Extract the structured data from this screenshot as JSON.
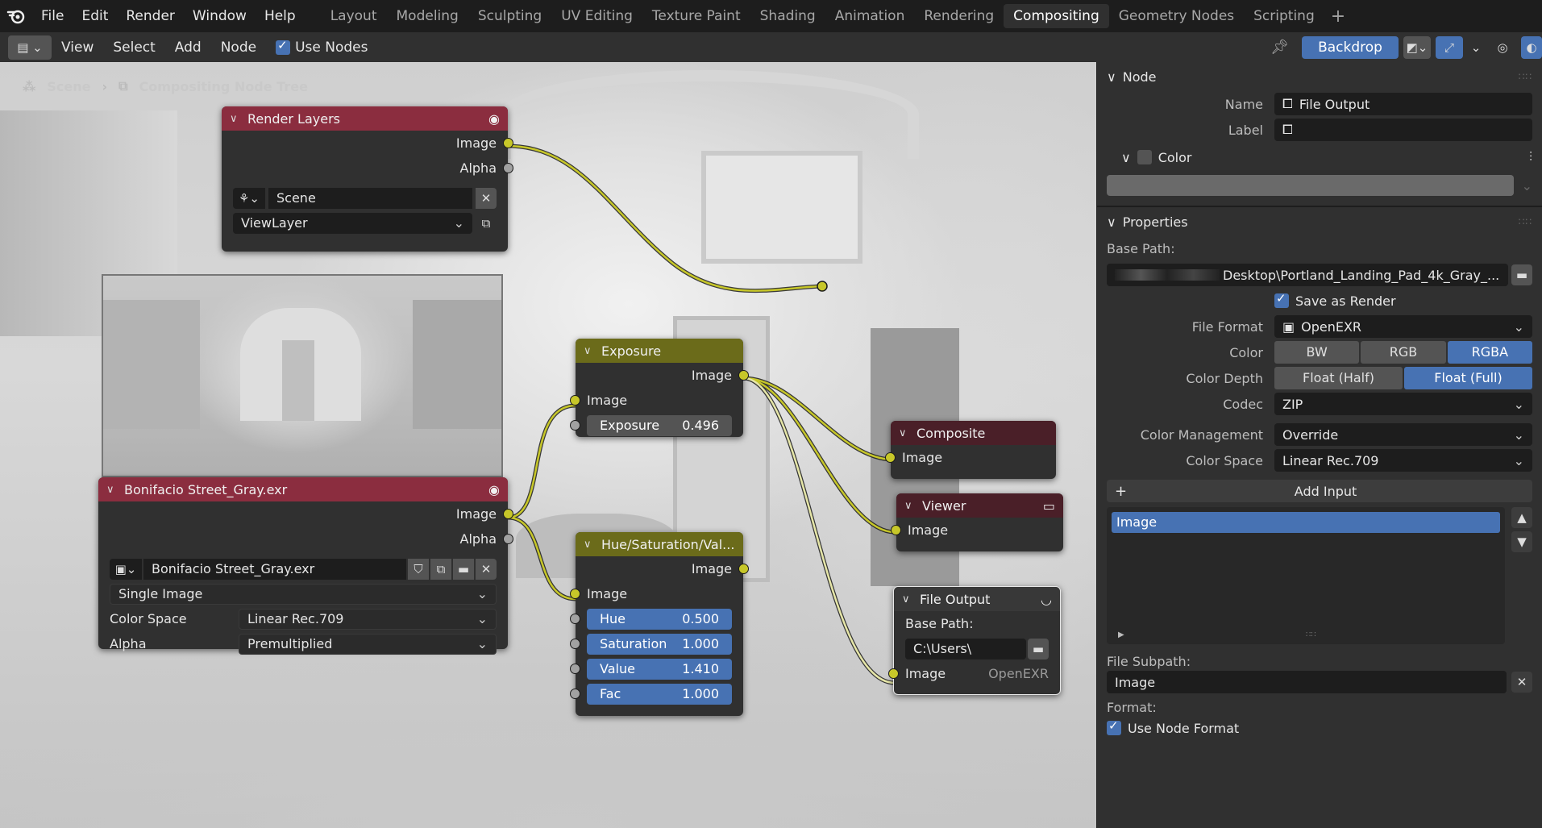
{
  "topbar": {
    "menus": [
      "File",
      "Edit",
      "Render",
      "Window",
      "Help"
    ],
    "workspaces": [
      "Layout",
      "Modeling",
      "Sculpting",
      "UV Editing",
      "Texture Paint",
      "Shading",
      "Animation",
      "Rendering",
      "Compositing",
      "Geometry Nodes",
      "Scripting"
    ],
    "active_workspace": "Compositing"
  },
  "header": {
    "menus": [
      "View",
      "Select",
      "Add",
      "Node"
    ],
    "use_nodes_label": "Use Nodes",
    "backdrop_label": "Backdrop"
  },
  "breadcrumb": {
    "scene": "Scene",
    "tree": "Compositing Node Tree"
  },
  "nodes": {
    "render_layers": {
      "title": "Render Layers",
      "out_image": "Image",
      "out_alpha": "Alpha",
      "scene": "Scene",
      "view_layer": "ViewLayer"
    },
    "image": {
      "title": "Bonifacio Street_Gray.exr",
      "out_image": "Image",
      "out_alpha": "Alpha",
      "image_name": "Bonifacio Street_Gray.exr",
      "source": "Single Image",
      "color_space_label": "Color Space",
      "color_space": "Linear Rec.709",
      "alpha_label": "Alpha",
      "alpha": "Premultiplied"
    },
    "exposure": {
      "title": "Exposure",
      "out_image": "Image",
      "in_image": "Image",
      "exposure_label": "Exposure",
      "exposure_value": "0.496"
    },
    "hue_sat": {
      "title": "Hue/Saturation/Val...",
      "out_image": "Image",
      "in_image": "Image",
      "sliders": [
        {
          "label": "Hue",
          "value": "0.500"
        },
        {
          "label": "Saturation",
          "value": "1.000"
        },
        {
          "label": "Value",
          "value": "1.410"
        },
        {
          "label": "Fac",
          "value": "1.000"
        }
      ]
    },
    "composite": {
      "title": "Composite",
      "in_image": "Image"
    },
    "viewer": {
      "title": "Viewer",
      "in_image": "Image"
    },
    "file_output": {
      "title": "File Output",
      "base_path_label": "Base Path:",
      "base_path": "C:\\Users\\",
      "in_image": "Image",
      "format": "OpenEXR"
    }
  },
  "sidebar": {
    "node_panel": {
      "title": "Node",
      "name_label": "Name",
      "name_value": "File Output",
      "label_label": "Label",
      "label_value": "",
      "color_label": "Color"
    },
    "properties_panel": {
      "title": "Properties",
      "base_path_label": "Base Path:",
      "base_path_value": "Desktop\\Portland_Landing_Pad_4k_Gray_...",
      "save_as_render": "Save as Render",
      "file_format_label": "File Format",
      "file_format": "OpenEXR",
      "color_label": "Color",
      "color_options": [
        "BW",
        "RGB",
        "RGBA"
      ],
      "color_selected": "RGBA",
      "color_depth_label": "Color Depth",
      "depth_options": [
        "Float (Half)",
        "Float (Full)"
      ],
      "depth_selected": "Float (Full)",
      "codec_label": "Codec",
      "codec": "ZIP",
      "color_management_label": "Color Management",
      "color_management": "Override",
      "color_space_label": "Color Space",
      "color_space": "Linear Rec.709",
      "add_input": "Add Input",
      "inputs": [
        "Image"
      ],
      "file_subpath_label": "File Subpath:",
      "file_subpath": "Image",
      "format_label": "Format:",
      "use_node_format": "Use Node Format"
    }
  },
  "colors": {
    "accent": "#4772b3",
    "socket_image": "#c7c729",
    "node_red": "#8b2d3f",
    "node_olive": "#6b6b1a"
  }
}
